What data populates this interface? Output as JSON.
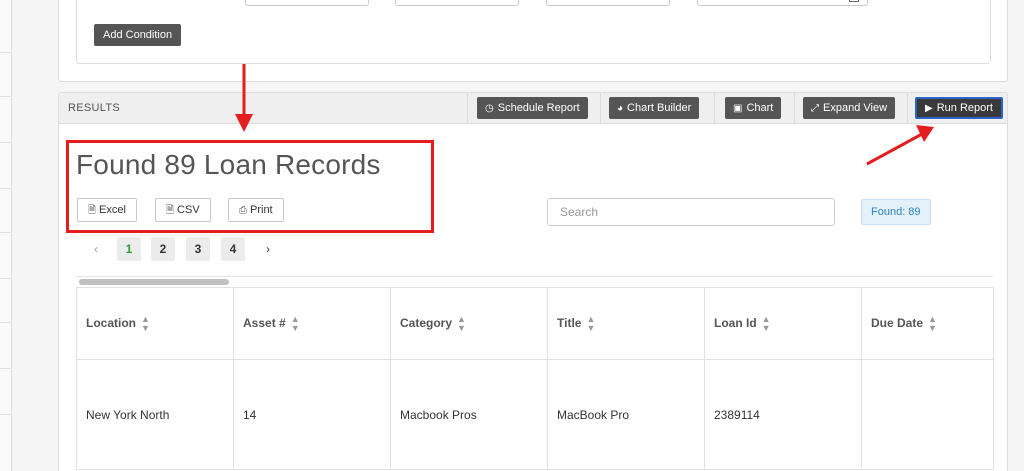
{
  "conditions": {
    "add_button": "Add Condition"
  },
  "results": {
    "section_title": "RESULTS",
    "toolbar": {
      "schedule_report": "Schedule Report",
      "chart_builder": "Chart Builder",
      "chart": "Chart",
      "expand_view": "Expand View",
      "run_report": "Run Report"
    },
    "heading": "Found 89 Loan Records",
    "export": {
      "excel": "Excel",
      "csv": "CSV",
      "print": "Print"
    },
    "search": {
      "placeholder": "Search",
      "value": ""
    },
    "found_badge": "Found: 89",
    "pagination": {
      "prev": "‹",
      "next": "›",
      "pages": [
        "1",
        "2",
        "3",
        "4"
      ],
      "current": "1"
    },
    "table": {
      "columns": [
        "Location",
        "Asset #",
        "Category",
        "Title",
        "Loan Id",
        "Due Date"
      ],
      "rows": [
        [
          "New York North",
          "14",
          "Macbook Pros",
          "MacBook Pro",
          "2389114",
          ""
        ]
      ]
    }
  },
  "icons": {
    "schedule": "clock-icon",
    "chart_builder": "pie-chart-icon",
    "chart": "image-icon",
    "expand": "expand-icon",
    "run": "play-icon",
    "excel": "file-excel-icon",
    "csv": "file-csv-icon",
    "print": "printer-icon",
    "sort": "sort-icon"
  },
  "annotation_color": "#e41e1e"
}
